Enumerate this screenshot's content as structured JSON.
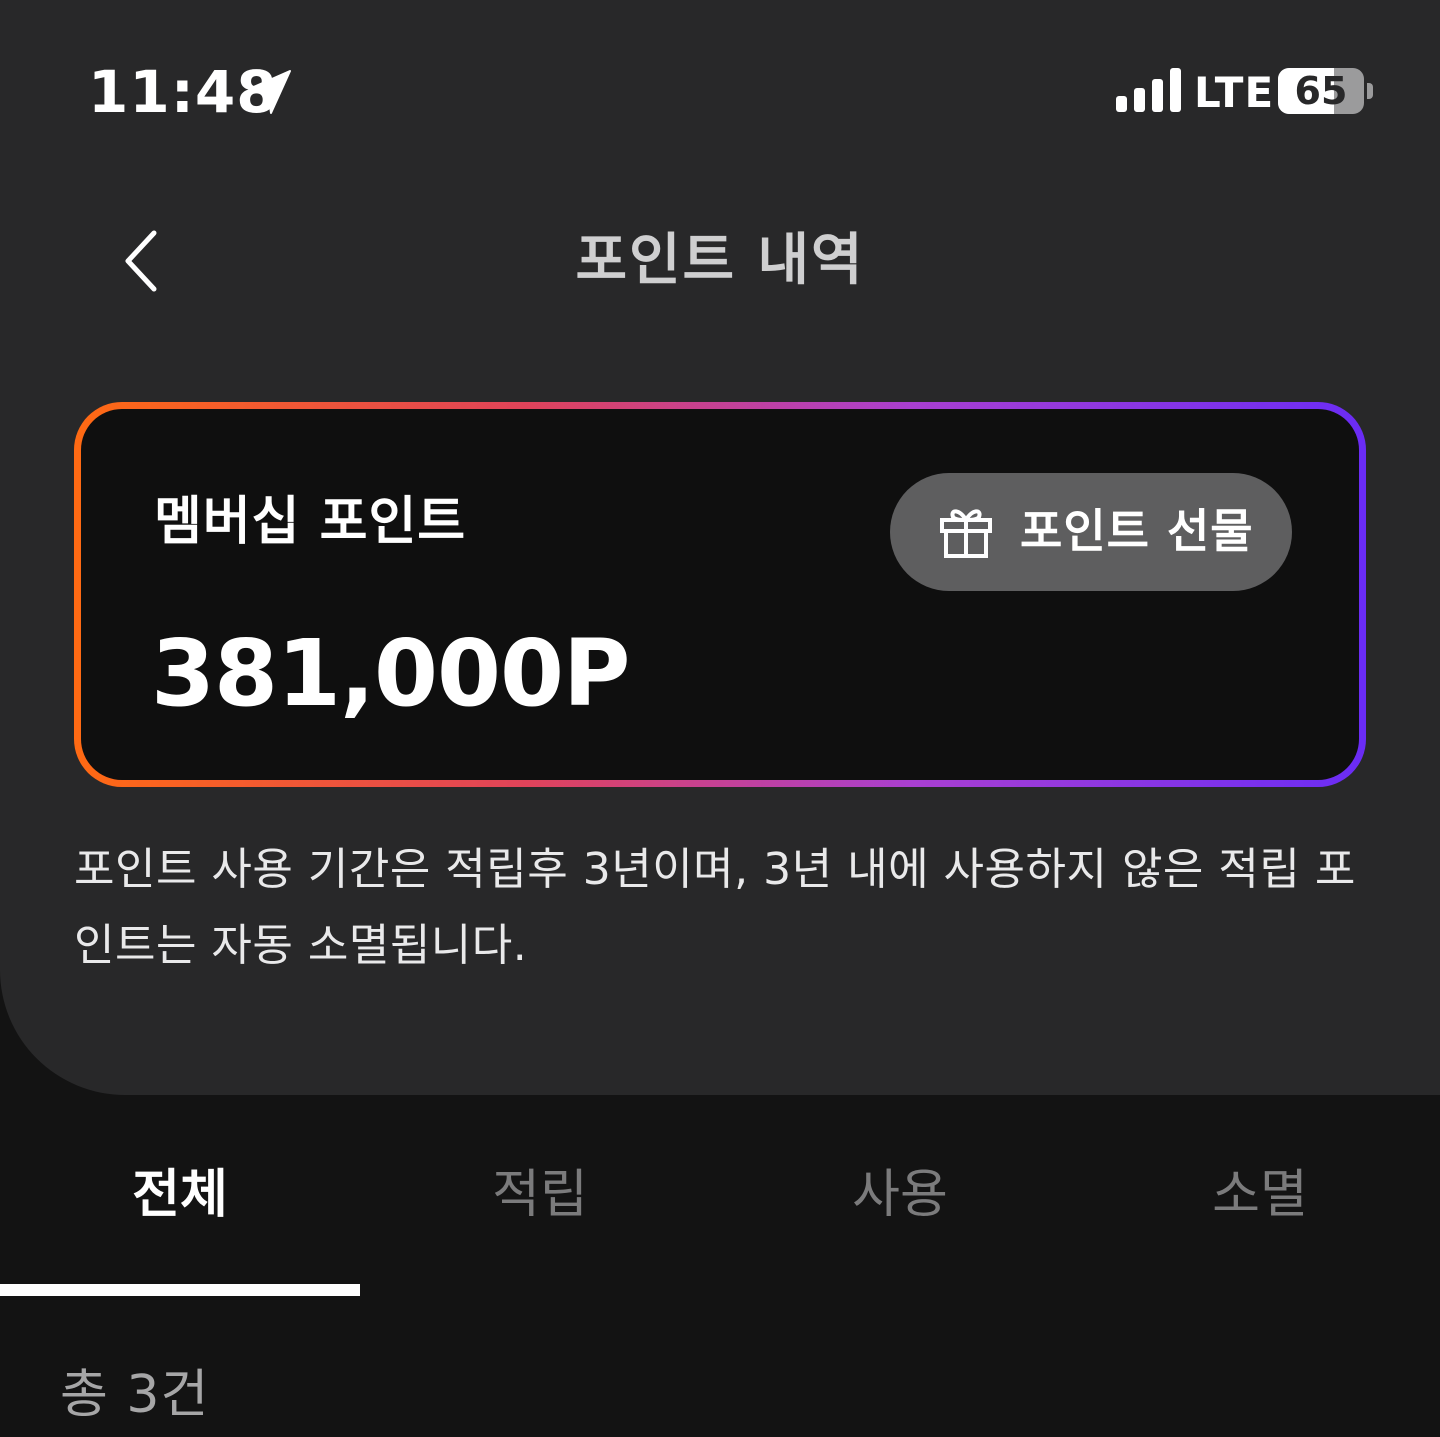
{
  "status_bar": {
    "time": "11:48",
    "network": "LTE",
    "battery": 65,
    "location_icon": "location-arrow-icon",
    "signal_icon": "cellular-signal-icon"
  },
  "header": {
    "back_icon": "chevron-left-icon",
    "title": "포인트 내역"
  },
  "points_card": {
    "label": "멤버십 포인트",
    "amount": "381,000P",
    "gift_button": {
      "icon": "gift-icon",
      "label": "포인트 선물"
    },
    "border_gradient": [
      "#ff6a13",
      "#e0435a",
      "#a93fd1",
      "#6a2cf5"
    ]
  },
  "notice": "포인트 사용 기간은 적립후 3년이며, 3년 내에 사용하지 않은 적립 포인트는 자동 소멸됩니다.",
  "tabs": [
    {
      "label": "전체",
      "active": true
    },
    {
      "label": "적립",
      "active": false
    },
    {
      "label": "사용",
      "active": false
    },
    {
      "label": "소멸",
      "active": false
    }
  ],
  "total_count": "총 3건",
  "colors": {
    "background": "#131313",
    "panel": "#282829",
    "button": "#5e5e5f",
    "inactive_tab": "#7b7b7c"
  }
}
